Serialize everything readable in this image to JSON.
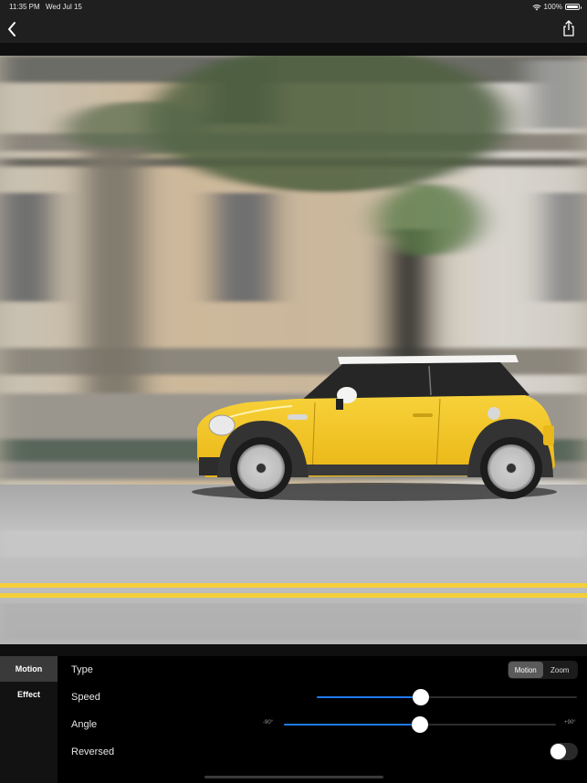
{
  "status_bar": {
    "time": "11:35 PM",
    "date": "Wed Jul 15",
    "wifi_icon": "wifi-icon",
    "battery_percent": "100%",
    "battery_level": 1.0
  },
  "nav_bar": {
    "back_icon": "chevron-left-icon",
    "share_icon": "share-icon"
  },
  "photo": {
    "description": "Yellow Mini Cooper with white roof driving past building with motion blur background",
    "subject_color": "#f3c21f",
    "road_line_color": "#f5cf3a"
  },
  "sidebar": {
    "items": [
      {
        "label": "Motion",
        "active": true
      },
      {
        "label": "Effect",
        "active": false
      }
    ]
  },
  "controls": {
    "type": {
      "label": "Type",
      "options": [
        "Motion",
        "Zoom"
      ],
      "selected": "Motion"
    },
    "speed": {
      "label": "Speed",
      "value_fraction": 0.4
    },
    "angle": {
      "label": "Angle",
      "min_label": "-90°",
      "max_label": "+90°",
      "value_fraction": 0.5
    },
    "reversed": {
      "label": "Reversed",
      "on": false
    }
  },
  "colors": {
    "accent": "#1e7bf0",
    "panel_bg": "#000000",
    "sidebar_bg": "#121212",
    "sidebar_active": "#3a3a3a",
    "bar_bg": "#1f1f1f"
  }
}
